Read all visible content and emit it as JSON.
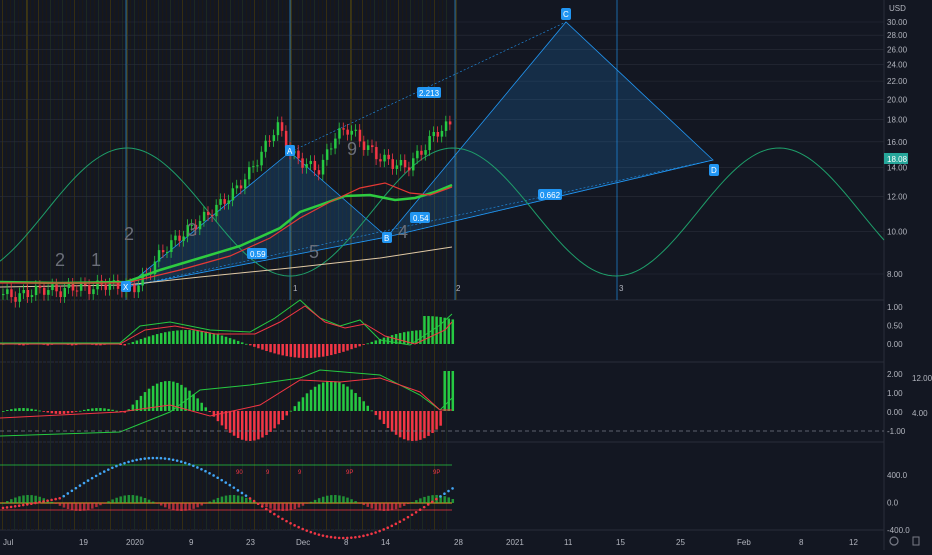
{
  "currency": "USD",
  "price_badge": "18.08",
  "colors": {
    "background": "#131722",
    "up": "#26c942",
    "down": "#f23645",
    "pattern": "#2196f3",
    "sine": "#1e9e6a",
    "grid": "#2a2e39"
  },
  "pattern_labels": {
    "X": "X",
    "A": "A",
    "B": "B",
    "C": "C",
    "D": "D"
  },
  "ratios": {
    "xab": "0.59",
    "abc": "0.54",
    "bcd": "2.213",
    "xad": "0.662"
  },
  "cycle_labels": [
    "1",
    "2",
    "3"
  ],
  "wave_labels": [
    "2",
    "1",
    "2",
    "3",
    "4",
    "5",
    "9"
  ],
  "pane1_right_values": [
    "12.00",
    "4.00"
  ],
  "signal_labels": [
    "90",
    "9",
    "9",
    "9P",
    "9P"
  ],
  "chart_data": {
    "type": "line",
    "panes": [
      {
        "name": "price",
        "log_scale": true,
        "y_ticks": [
          "30.00",
          "28.00",
          "26.00",
          "24.00",
          "22.00",
          "20.00",
          "18.00",
          "16.00",
          "14.00",
          "12.00",
          "10.00",
          "8.00"
        ],
        "last_value": 18.08,
        "approx_close": [
          7.2,
          7.1,
          7.3,
          7.4,
          7.3,
          7.5,
          7.4,
          7.6,
          7.5,
          7.4,
          8.0,
          9.0,
          9.6,
          10.2,
          10.8,
          11.5,
          12.3,
          13.5,
          15.2,
          17.5,
          15.0,
          14.2,
          13.8,
          16.5,
          17.2,
          15.8,
          14.8,
          14.3,
          14.0,
          15.2,
          16.8,
          17.5
        ]
      },
      {
        "name": "oscillator_1",
        "y_ticks": [
          "1.00",
          "0.50",
          "0.00"
        ]
      },
      {
        "name": "oscillator_2",
        "y_ticks": [
          "2.00",
          "1.00",
          "0.00",
          "-1.00"
        ]
      },
      {
        "name": "oscillator_3",
        "y_ticks": [
          "400.0",
          "0.0",
          "-400.0"
        ]
      }
    ],
    "x_labels": [
      "Jul",
      "19",
      "2020",
      "9",
      "23",
      "Dec",
      "8",
      "14",
      "28",
      "2021",
      "11",
      "15",
      "25",
      "Feb",
      "8",
      "12"
    ]
  }
}
